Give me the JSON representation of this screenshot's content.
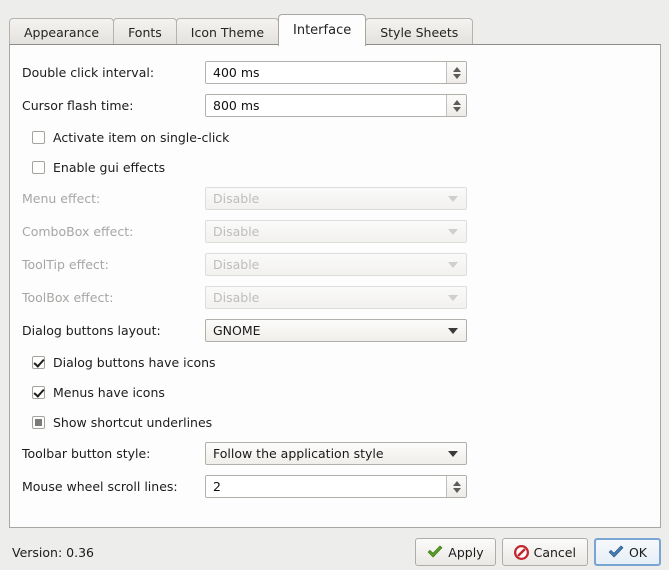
{
  "tabs": [
    {
      "label": "Appearance",
      "active": false
    },
    {
      "label": "Fonts",
      "active": false
    },
    {
      "label": "Icon Theme",
      "active": false
    },
    {
      "label": "Interface",
      "active": true
    },
    {
      "label": "Style Sheets",
      "active": false
    }
  ],
  "form": {
    "double_click": {
      "label": "Double click interval:",
      "value": "400 ms"
    },
    "cursor_flash": {
      "label": "Cursor flash time:",
      "value": "800 ms"
    },
    "activate_single_click": {
      "label": "Activate item on single-click",
      "state": "unchecked"
    },
    "enable_gui_effects": {
      "label": "Enable gui effects",
      "state": "unchecked"
    },
    "menu_effect": {
      "label": "Menu effect:",
      "value": "Disable",
      "enabled": false
    },
    "combobox_effect": {
      "label": "ComboBox effect:",
      "value": "Disable",
      "enabled": false
    },
    "tooltip_effect": {
      "label": "ToolTip effect:",
      "value": "Disable",
      "enabled": false
    },
    "toolbox_effect": {
      "label": "ToolBox effect:",
      "value": "Disable",
      "enabled": false
    },
    "dialog_buttons_layout": {
      "label": "Dialog buttons layout:",
      "value": "GNOME",
      "enabled": true
    },
    "dialog_buttons_icons": {
      "label": "Dialog buttons have icons",
      "state": "checked"
    },
    "menus_have_icons": {
      "label": "Menus have icons",
      "state": "checked"
    },
    "shortcut_underlines": {
      "label": "Show shortcut underlines",
      "state": "partial"
    },
    "toolbar_button_style": {
      "label": "Toolbar button style:",
      "value": "Follow the application style",
      "enabled": true
    },
    "mouse_wheel_scroll": {
      "label": "Mouse wheel scroll lines:",
      "value": "2"
    }
  },
  "footer": {
    "version": "Version: 0.36",
    "apply_label": "Apply",
    "cancel_label": "Cancel",
    "ok_label": "OK"
  },
  "colors": {
    "apply_icon": "#5aa02c",
    "cancel_icon": "#c1272d",
    "ok_icon": "#3b6ea5",
    "focus_border": "#7aa5d2",
    "panel_bg": "#fdfdfd",
    "window_bg": "#ededeb"
  }
}
